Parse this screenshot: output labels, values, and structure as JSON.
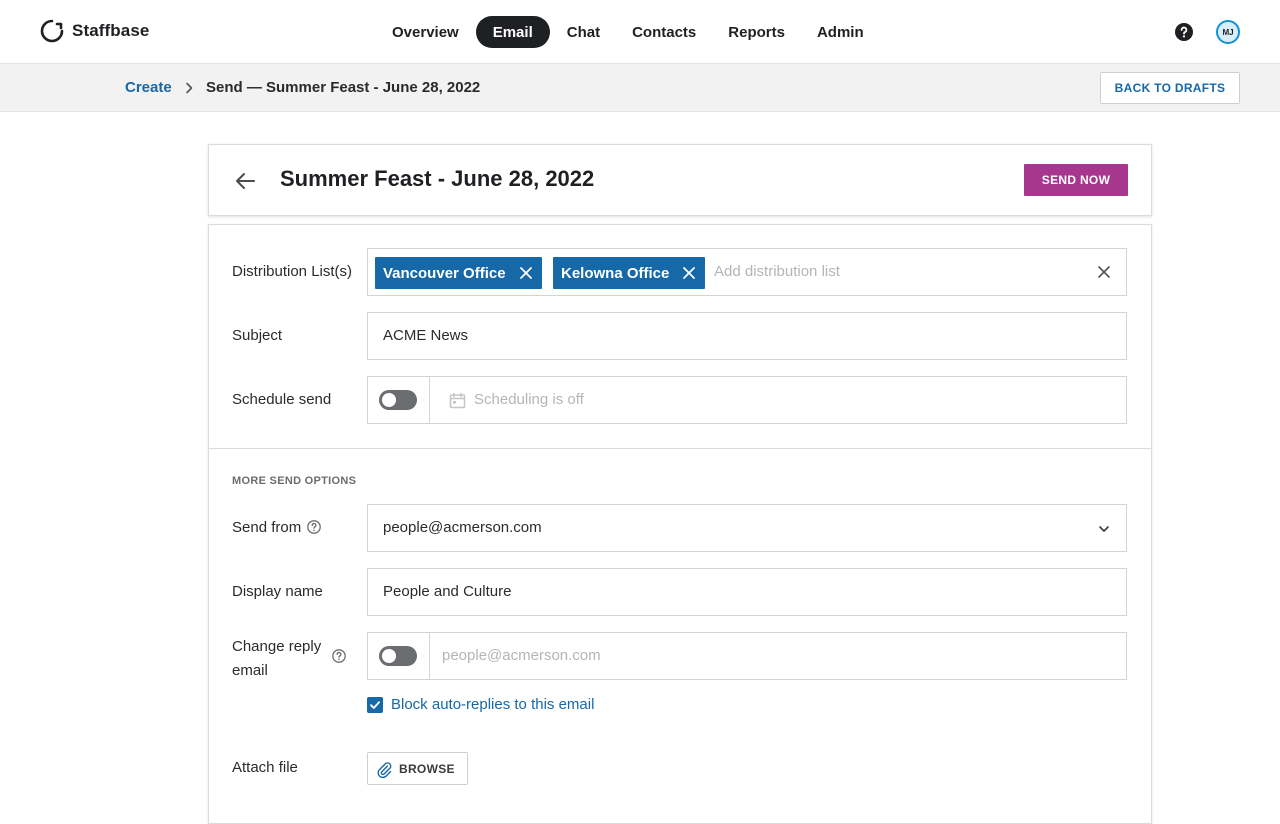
{
  "app": {
    "name": "Staffbase"
  },
  "nav": {
    "items": [
      {
        "label": "Overview",
        "active": false
      },
      {
        "label": "Email",
        "active": true
      },
      {
        "label": "Chat",
        "active": false
      },
      {
        "label": "Contacts",
        "active": false
      },
      {
        "label": "Reports",
        "active": false
      },
      {
        "label": "Admin",
        "active": false
      }
    ],
    "avatar_initials": "MJ"
  },
  "breadcrumb": {
    "link": "Create",
    "current": "Send — Summer Feast - June 28, 2022",
    "back_button": "BACK TO DRAFTS"
  },
  "header": {
    "title": "Summer Feast - June 28, 2022",
    "send_button": "SEND NOW"
  },
  "form": {
    "distribution": {
      "label": "Distribution List(s)",
      "chips": [
        "Vancouver Office",
        "Kelowna Office"
      ],
      "placeholder": "Add distribution list"
    },
    "subject": {
      "label": "Subject",
      "value": "ACME News"
    },
    "schedule": {
      "label": "Schedule send",
      "enabled": false,
      "placeholder": "Scheduling is off"
    },
    "more_options_heading": "MORE SEND OPTIONS",
    "send_from": {
      "label": "Send from",
      "value": "people@acmerson.com"
    },
    "display_name": {
      "label": "Display name",
      "value": "People and Culture"
    },
    "reply_email": {
      "label_line1": "Change reply",
      "label_line2": "email",
      "enabled": false,
      "placeholder": "people@acmerson.com"
    },
    "block_auto_replies": {
      "label": "Block auto-replies to this email",
      "checked": true
    },
    "attach": {
      "label": "Attach file",
      "button": "BROWSE"
    }
  },
  "colors": {
    "brand_blue": "#1668a7",
    "send_purple": "#a7368f",
    "nav_active": "#1f2023"
  }
}
